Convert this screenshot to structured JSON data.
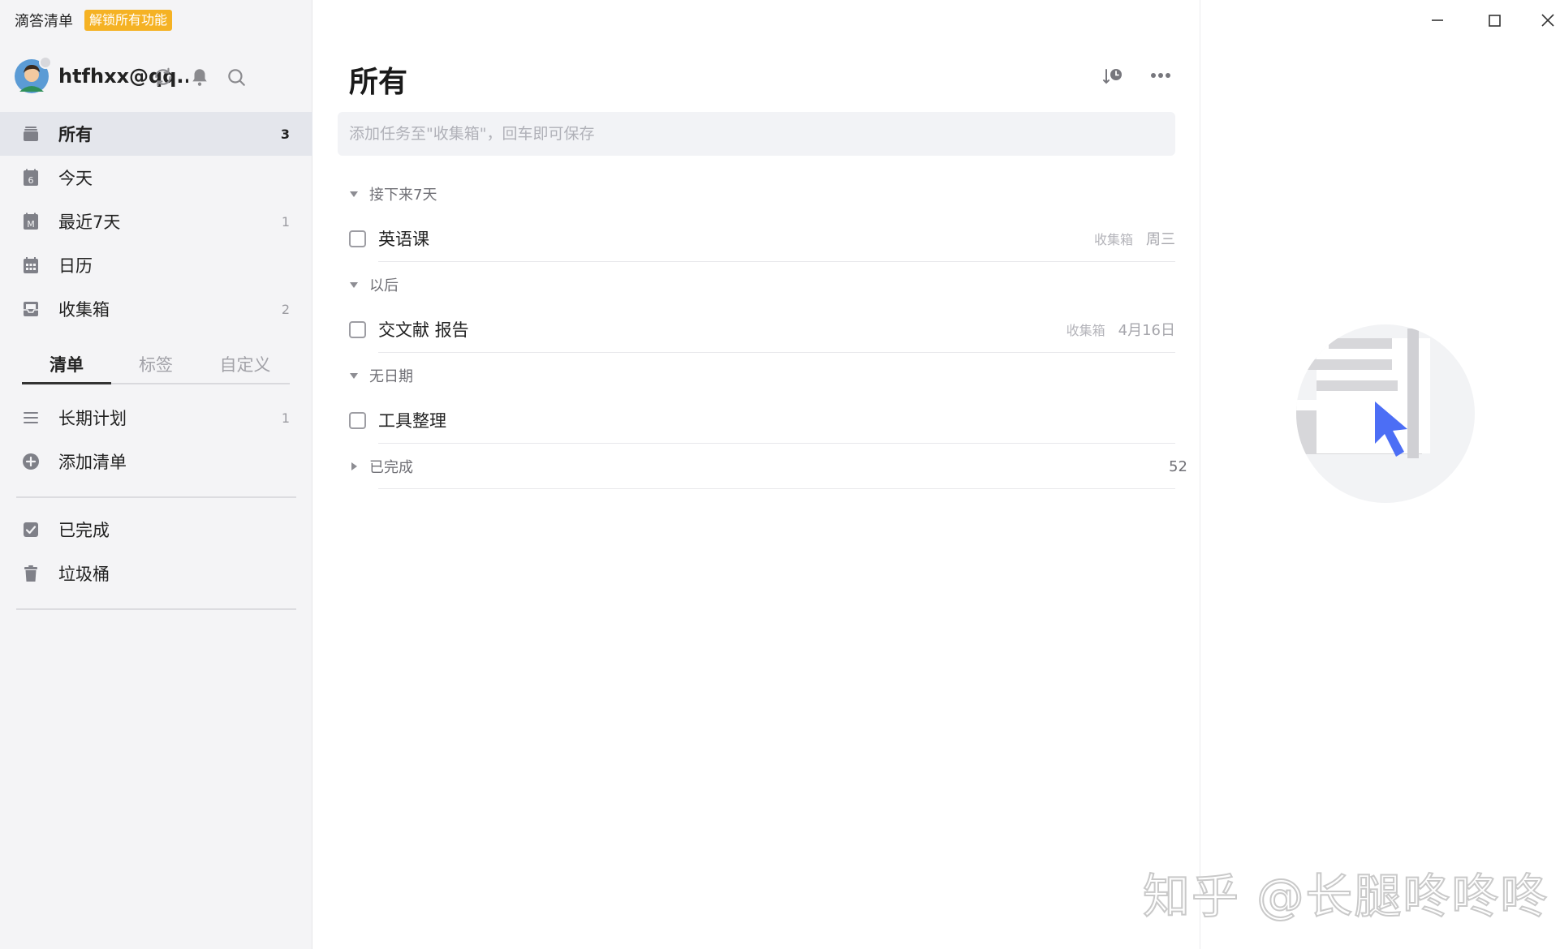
{
  "app": {
    "name": "滴答清单",
    "unlock_badge": "解锁所有功能"
  },
  "account": {
    "name": "htfhxx@qq..."
  },
  "sidebar": {
    "smart_lists": [
      {
        "label": "所有",
        "count": "3",
        "icon": "inbox-tray-icon",
        "active": true
      },
      {
        "label": "今天",
        "count": "",
        "icon": "calendar-day-icon",
        "day": "6"
      },
      {
        "label": "最近7天",
        "count": "1",
        "icon": "calendar-week-icon",
        "letter": "M"
      },
      {
        "label": "日历",
        "count": "",
        "icon": "calendar-grid-icon"
      },
      {
        "label": "收集箱",
        "count": "2",
        "icon": "inbox-icon"
      }
    ],
    "tabs": [
      {
        "label": "清单",
        "active": true
      },
      {
        "label": "标签",
        "active": false
      },
      {
        "label": "自定义",
        "active": false
      }
    ],
    "lists": [
      {
        "label": "长期计划",
        "count": "1",
        "icon": "list-lines-icon"
      },
      {
        "label": "添加清单",
        "count": "",
        "icon": "add-circle-icon"
      }
    ],
    "system": [
      {
        "label": "已完成",
        "icon": "checked-box-icon"
      },
      {
        "label": "垃圾桶",
        "icon": "trash-icon"
      }
    ]
  },
  "main": {
    "title": "所有",
    "quick_add_placeholder": "添加任务至\"收集箱\"，回车即可保存",
    "sections": [
      {
        "label": "接下来7天",
        "expanded": true,
        "tasks": [
          {
            "title": "英语课",
            "list": "收集箱",
            "date": "周三"
          }
        ]
      },
      {
        "label": "以后",
        "expanded": true,
        "tasks": [
          {
            "title": "交文献 报告",
            "list": "收集箱",
            "date": "4月16日"
          }
        ]
      },
      {
        "label": "无日期",
        "expanded": true,
        "tasks": [
          {
            "title": "工具整理",
            "list": "",
            "date": ""
          }
        ]
      },
      {
        "label": "已完成",
        "expanded": false,
        "count": "52",
        "tasks": []
      }
    ]
  },
  "detail": {
    "illustration": "task-detail-placeholder-illustration"
  },
  "watermark": "知乎 @长腿咚咚咚",
  "colors": {
    "accent": "#4c6ef5",
    "badge": "#f5b224",
    "sidebar_bg": "#f4f4f6",
    "active_bg": "#e4e6ec"
  }
}
